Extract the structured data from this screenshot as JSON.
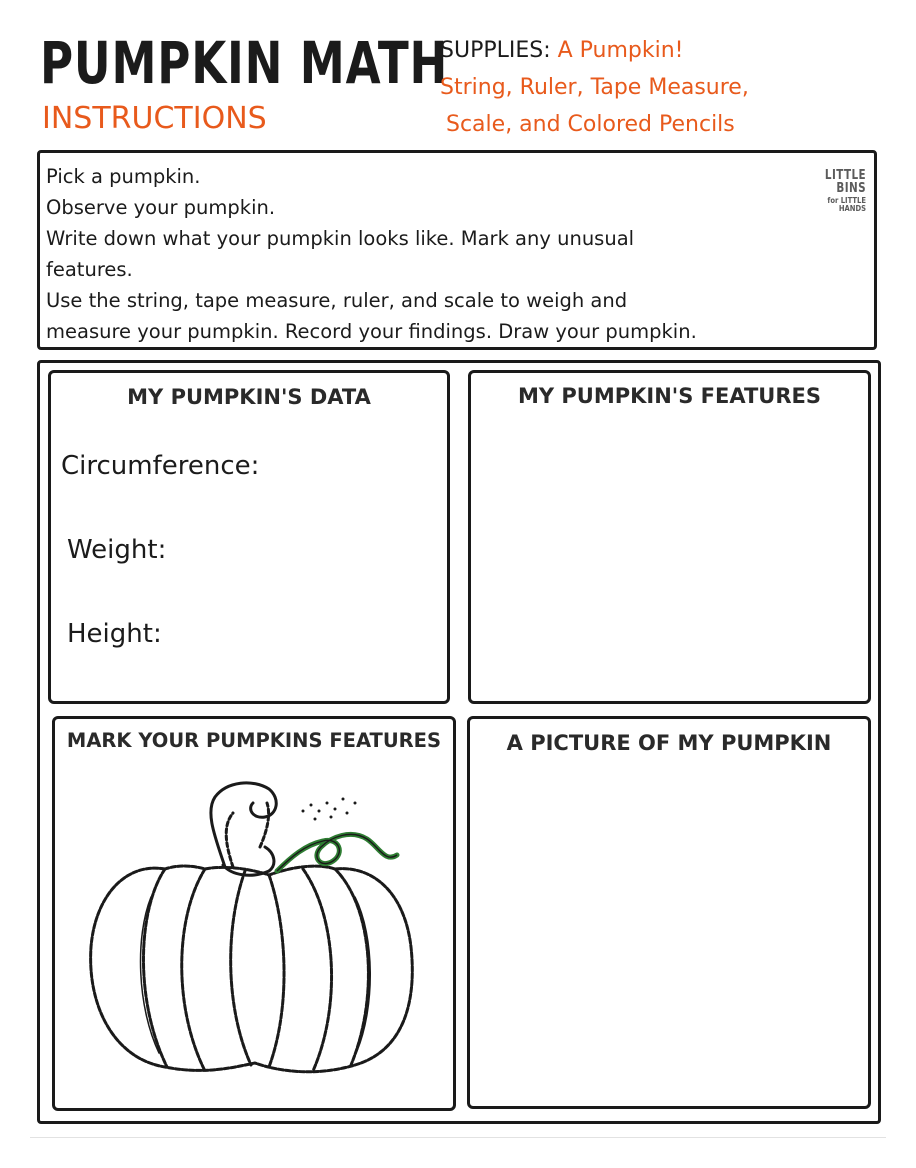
{
  "header": {
    "title": "PUMPKIN MATH",
    "subtitle": "INSTRUCTIONS",
    "supplies_label": "SUPPLIES:",
    "supplies_line1": "A Pumpkin!",
    "supplies_line2": "String, Ruler, Tape Measure,",
    "supplies_line3": "Scale, and Colored Pencils"
  },
  "instructions": {
    "lines": [
      "Pick a pumpkin.",
      "Observe your pumpkin.",
      "Write down what your pumpkin looks like. Mark any unusual",
      "features.",
      "Use the string, tape measure, ruler, and scale to weigh and",
      "measure your pumpkin. Record your findings. Draw your pumpkin."
    ],
    "logo_line1": "LITTLE BINS",
    "logo_line2": "for LITTLE HANDS"
  },
  "panels": {
    "data": {
      "title": "MY PUMPKIN'S DATA",
      "fields": [
        "Circumference:",
        "Weight:",
        "Height:"
      ]
    },
    "features": {
      "title": "MY PUMPKIN'S FEATURES"
    },
    "mark": {
      "title": "MARK YOUR PUMPKINS FEATURES",
      "image": "pumpkin-outline-drawing"
    },
    "picture": {
      "title": "A PICTURE OF MY PUMPKIN"
    }
  },
  "colors": {
    "accent_orange": "#e85a1c",
    "ink": "#1a1a1a",
    "stem_green": "#2e7d32"
  }
}
